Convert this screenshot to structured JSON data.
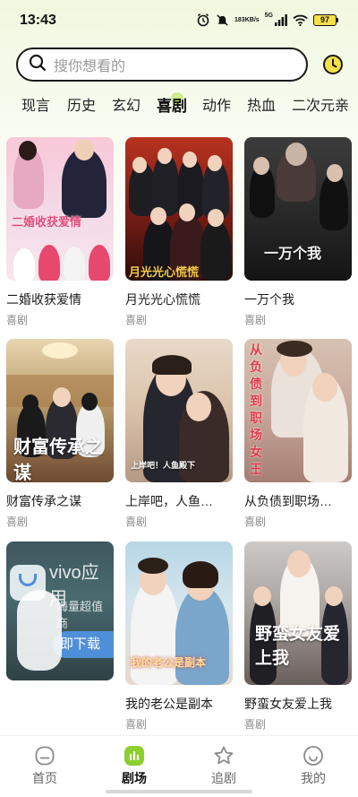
{
  "status_bar": {
    "time": "13:43",
    "net_speed_value": "183",
    "net_speed_unit": "KB/s",
    "network_type": "5G",
    "battery": "97",
    "icons": [
      "alarm-icon",
      "mute-icon",
      "signal-icon",
      "wifi-icon",
      "battery-icon"
    ]
  },
  "search": {
    "placeholder": "搜你想看的",
    "icon": "search-icon",
    "history_icon": "history-clock-icon"
  },
  "tabs": [
    {
      "label": "现言",
      "active": false
    },
    {
      "label": "历史",
      "active": false
    },
    {
      "label": "玄幻",
      "active": false
    },
    {
      "label": "喜剧",
      "active": true
    },
    {
      "label": "动作",
      "active": false
    },
    {
      "label": "热血",
      "active": false
    },
    {
      "label": "二次元",
      "active": false
    },
    {
      "label": "亲",
      "active": false
    }
  ],
  "dramas": [
    {
      "title": "二婚收获爱情",
      "genre": "喜剧",
      "poster_text": "二婚收获爱情"
    },
    {
      "title": "月光光心慌慌",
      "genre": "喜剧",
      "poster_text": "月光光心慌慌"
    },
    {
      "title": "一万个我",
      "genre": "喜剧",
      "poster_text": "一万个我"
    },
    {
      "title": "财富传承之谋",
      "genre": "喜剧",
      "poster_text": "财富传承之谋"
    },
    {
      "title": "上岸吧，人鱼…",
      "genre": "喜剧",
      "poster_text": "上岸吧！人鱼殿下"
    },
    {
      "title": "从负债到职场…",
      "genre": "喜剧",
      "poster_text": "从负债到职场女王"
    },
    {
      "title": "",
      "genre": "",
      "poster_text": "vivo应用",
      "poster_subtext": "海量超值商",
      "poster_button": "即下载"
    },
    {
      "title": "我的老公是副本",
      "genre": "喜剧",
      "poster_text": "我的老公是副本"
    },
    {
      "title": "野蛮女友爱上我",
      "genre": "喜剧",
      "poster_text": "野蛮女友爱上我"
    }
  ],
  "bottom_nav": [
    {
      "label": "首页",
      "icon": "home-icon",
      "active": false
    },
    {
      "label": "剧场",
      "icon": "theater-icon",
      "active": true
    },
    {
      "label": "追剧",
      "icon": "star-icon",
      "active": false
    },
    {
      "label": "我的",
      "icon": "profile-icon",
      "active": false
    }
  ],
  "colors": {
    "accent": "#8ccf2e",
    "background_top": "#f1f8df",
    "text_primary": "#1a1a1a",
    "text_secondary": "#8a8a8a"
  }
}
